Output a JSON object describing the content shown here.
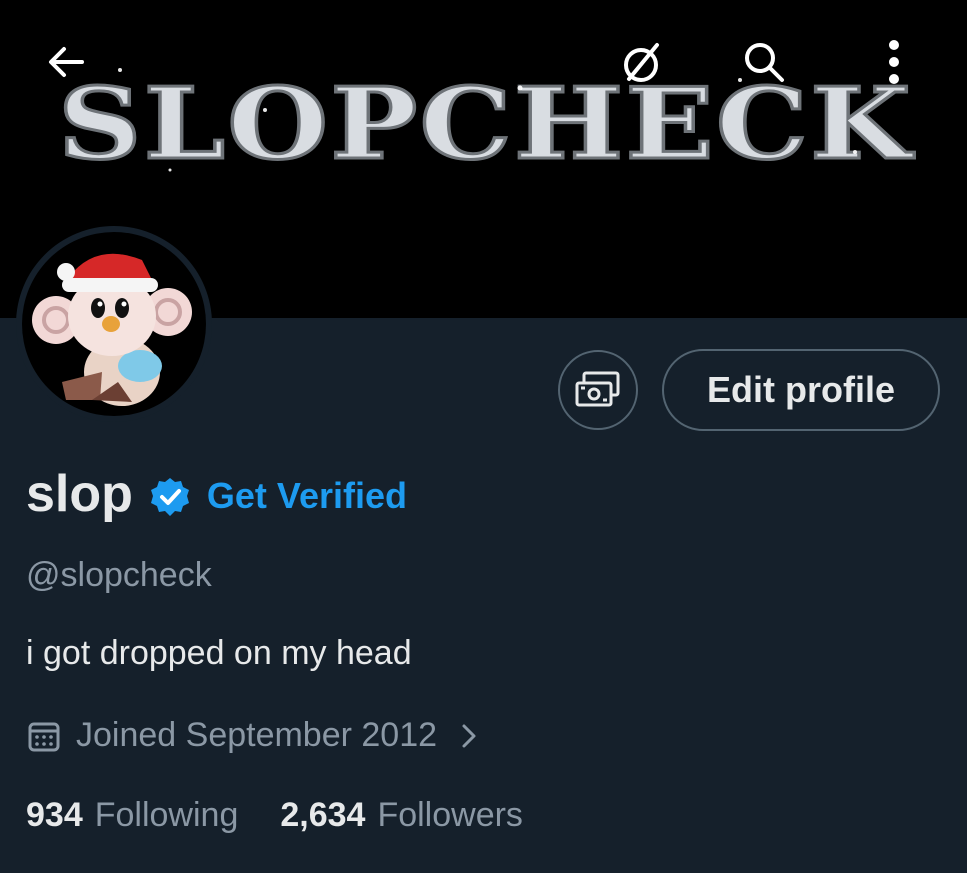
{
  "banner": {
    "art_text": "SLOPCHECK",
    "icons": [
      "back-arrow-icon",
      "no-location-icon",
      "search-icon",
      "more-vertical-icon"
    ]
  },
  "profile": {
    "name": "slop",
    "get_verified_label": "Get Verified",
    "handle": "@slopcheck",
    "bio": "i got dropped on my head",
    "joined": "Joined September 2012",
    "edit_profile_label": "Edit profile",
    "following_count": "934",
    "following_label": "Following",
    "followers_count": "2,634",
    "followers_label": "Followers"
  },
  "colors": {
    "background": "#15202b",
    "banner": "#000000",
    "accent": "#1d9bf0",
    "muted_text": "#8b98a5",
    "border": "#536471"
  }
}
